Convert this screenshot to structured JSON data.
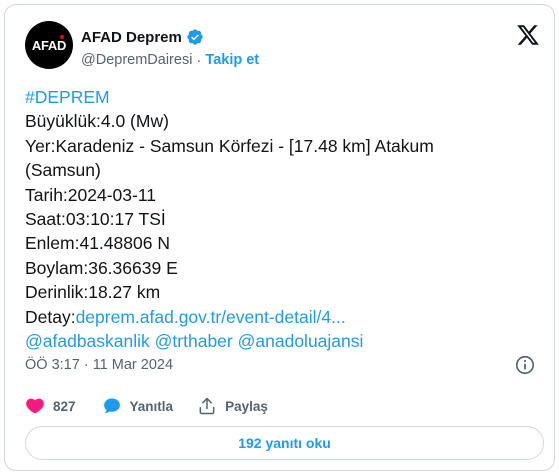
{
  "author": {
    "avatar_text": "AFAD",
    "display_name": "AFAD Deprem",
    "handle": "@DepremDairesi",
    "separator": "·",
    "follow_label": "Takip et"
  },
  "tweet": {
    "hashtag": "#DEPREM",
    "magnitude": "Büyüklük:4.0 (Mw)",
    "location_line1": "Yer:Karadeniz - Samsun Körfezi - [17.48 km] Atakum",
    "location_line2": "(Samsun)",
    "date": "Tarih:2024-03-11",
    "time": "Saat:03:10:17 TSİ",
    "latitude": "Enlem:41.48806 N",
    "longitude": "Boylam:36.36639 E",
    "depth": "Derinlik:18.27 km",
    "detail_label": "Detay:",
    "detail_link": "deprem.afad.gov.tr/event-detail/4...",
    "mentions": [
      "@afadbaskanlik",
      "@trthaber",
      "@anadoluajansi"
    ]
  },
  "meta": {
    "timestamp": "ÖÖ 3:17 · 11 Mar 2024"
  },
  "actions": {
    "like_count": "827",
    "reply_label": "Yanıtla",
    "share_label": "Paylaş"
  },
  "footer": {
    "read_replies_label": "192 yanıtı oku"
  },
  "colors": {
    "accent": "#1d9bf0",
    "like": "#f91880",
    "text": "#0f1419",
    "muted": "#536471",
    "border": "#cfd9de"
  }
}
